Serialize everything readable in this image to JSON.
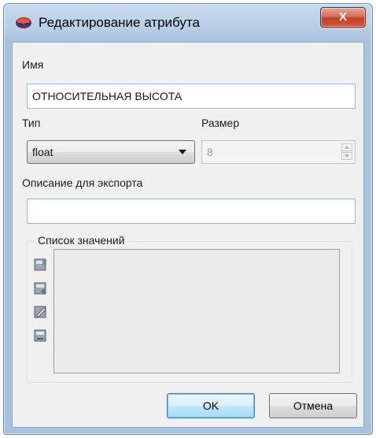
{
  "window": {
    "title": "Редактирование атрибута",
    "close_label": "X"
  },
  "form": {
    "name_label": "Имя",
    "name_value": "ОТНОСИТЕЛЬНАЯ ВЫСОТА",
    "type_label": "Тип",
    "type_value": "float",
    "size_label": "Размер",
    "size_value": "8",
    "description_label": "Описание для экспорта",
    "description_value": ""
  },
  "values_group": {
    "title": "Список значений",
    "tools": [
      "add-value-icon",
      "import-values-icon",
      "edit-value-icon",
      "delete-value-icon"
    ]
  },
  "buttons": {
    "ok_label": "OK",
    "cancel_label": "Отмена"
  },
  "colors": {
    "titlebar": "#b9cfe6",
    "close_button": "#c1402a",
    "client_background": "#f0f0f0",
    "input_border": "#a3b9d8"
  }
}
